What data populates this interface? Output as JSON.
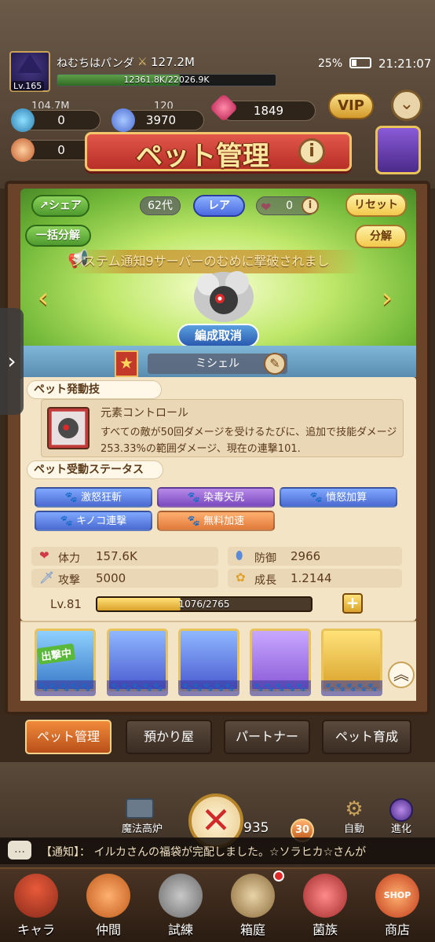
{
  "status": {
    "player_name": "ねむちはパンダ",
    "level": "Lv.165",
    "power": "127.2M",
    "exp_text": "12361.8K/22026.9K",
    "exp_fraction": 0.561,
    "battery": "25%",
    "time": "21:21:07"
  },
  "resources": {
    "top_left_partial": "104.7M",
    "top_mid_partial": "120",
    "left_1": "0",
    "mid_1": "3970",
    "gem": "1849",
    "left_2": "0"
  },
  "vip_label": "VIP",
  "title": "ペット管理",
  "info_icon": "i",
  "stage": {
    "share_label": "シェア",
    "bulk_decompose_label": "一括分解",
    "generation": "62代",
    "rarity": "レア",
    "hearts": "0",
    "reset_label": "リセット",
    "decompose_label": "分解",
    "notice": "システム通知9サーバーのむめに撃破されまし",
    "unequip_label": "編成取消",
    "pet_name": "ミシェル"
  },
  "active_skill": {
    "header": "ペット発動技",
    "name": "元素コントロール",
    "desc": "すべての敵が50回ダメージを受けるたびに、追加で技能ダメージ253.33%の範囲ダメージ、現在の連撃101."
  },
  "passive": {
    "header": "ペット受動ステータス",
    "tags": [
      "激怒狂斬",
      "染毒矢尻",
      "憤怒加算",
      "キノコ連撃",
      "無料加速"
    ]
  },
  "stats": {
    "hp_label": "体力",
    "hp_value": "157.6K",
    "def_label": "防御",
    "def_value": "2966",
    "atk_label": "攻撃",
    "atk_value": "5000",
    "growth_label": "成長",
    "growth_value": "1.2144"
  },
  "pet_level": {
    "level": "Lv.81",
    "progress_text": "1076/2765",
    "progress_fraction": 0.389
  },
  "roster": {
    "deployed_label": "出撃中"
  },
  "tabs": [
    "ペット管理",
    "預かり屋",
    "パートナー",
    "ペット育成"
  ],
  "lower": {
    "furnace_label": "魔法高炉",
    "count": "935",
    "count_badge": "30",
    "auto_label": "自動",
    "evolve_label": "進化"
  },
  "ticker": {
    "text": "【通知】： イルカさんの福袋が完配しました。☆ソラヒカ☆さんが"
  },
  "nav": [
    "キャラ",
    "仲間",
    "試練",
    "箱庭",
    "菌族",
    "商店"
  ],
  "shop_sign": "SHOP",
  "colors": {
    "accent_red": "#c33a2a",
    "gold": "#f3c66b",
    "panel_bg": "#f3e4c6"
  }
}
